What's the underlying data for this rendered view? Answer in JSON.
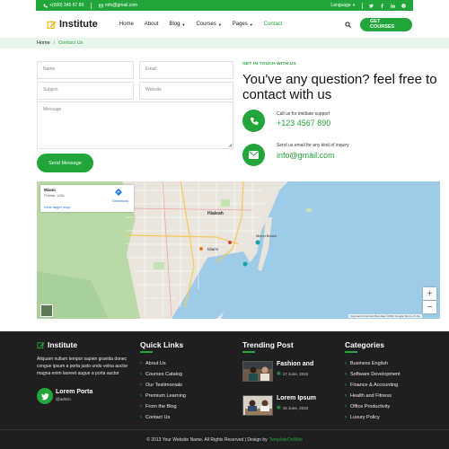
{
  "topbar": {
    "phone": "+(000) 345 67 89",
    "email": "info@gmail.com",
    "language": "Language",
    "socials": [
      "twitter-icon",
      "facebook-icon",
      "linkedin-icon",
      "pinterest-icon"
    ]
  },
  "nav": {
    "logo": "Institute",
    "items": [
      {
        "label": "Home",
        "dropdown": false
      },
      {
        "label": "About",
        "dropdown": false
      },
      {
        "label": "Blog",
        "dropdown": true
      },
      {
        "label": "Courses",
        "dropdown": true
      },
      {
        "label": "Pages",
        "dropdown": true
      },
      {
        "label": "Contact",
        "dropdown": false
      }
    ],
    "active": "Contact",
    "cta": "GET COURSES"
  },
  "breadcrumb": {
    "home": "Home",
    "separator": "/",
    "current": "Contact Us"
  },
  "form": {
    "name_placeholder": "Name",
    "email_placeholder": "Email",
    "subject_placeholder": "Subject",
    "website_placeholder": "Website",
    "message_placeholder": "Message",
    "submit": "Send Message"
  },
  "contact": {
    "eyebrow": "GET IN TOUCH WITH US",
    "title": "You've any question? feel free to contact with us",
    "phone_label": "Call us for imidiate support",
    "phone": "+123 4567 890",
    "email_label": "Send us email for any kind of inquiry",
    "email": "info@gmail.com"
  },
  "map": {
    "place_name": "Miami",
    "place_region": "Florida, USA",
    "directions": "Directions",
    "larger_map": "View larger map",
    "footer_text": "Keyboard shortcuts   Map data ©2024 Google   Terms of Use",
    "labels": [
      "Hialeah",
      "Miami",
      "Miami Beach"
    ]
  },
  "footer": {
    "logo": "Institute",
    "about": "Aliquam nullam tempor sapien gravida donec congue ipsum a porta justo undo velna auctor magna enim laoreet augue a porta auctor",
    "author_name": "Lorem Porta",
    "author_handle": "@admin",
    "quick_links_title": "Quick Links",
    "quick_links": [
      "About Us",
      "Courses Catalog",
      "Our Testimonials",
      "Premium Learning",
      "From the Blog",
      "Contact Us"
    ],
    "trending_title": "Trending Post",
    "posts": [
      {
        "title": "Fashion and",
        "date": "17 June, 2022"
      },
      {
        "title": "Lorem Ipsum",
        "date": "16 June, 2022"
      }
    ],
    "categories_title": "Categories",
    "categories": [
      "Business English",
      "Software Development",
      "Finance & Accounting",
      "Health and Fitness",
      "Office Productivity",
      "Luxury Policy"
    ],
    "copyright": "© 2013 Your Website Name. All Rights Reserved | Design by",
    "designer": "TemplateOnWeb"
  },
  "colors": {
    "accent": "#22a53b",
    "footer_bg": "#1f1f1f",
    "breadcrumb_bg": "#e9f6ec"
  }
}
